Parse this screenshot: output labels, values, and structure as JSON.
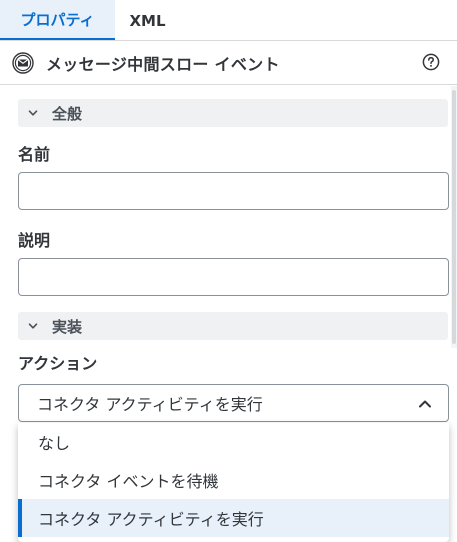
{
  "tabs": [
    {
      "label": "プロパティ",
      "active": true
    },
    {
      "label": "XML",
      "active": false
    }
  ],
  "header": {
    "title": "メッセージ中間スロー イベント",
    "icon": "envelope-event-icon",
    "help_icon": "help-icon"
  },
  "sections": {
    "general": {
      "label": "全般",
      "expanded": true
    },
    "implementation": {
      "label": "実装",
      "expanded": true
    }
  },
  "fields": {
    "name": {
      "label": "名前",
      "value": "",
      "placeholder": ""
    },
    "description": {
      "label": "説明",
      "value": "",
      "placeholder": ""
    },
    "action": {
      "label": "アクション",
      "selected": "コネクタ アクティビティを実行",
      "open": true,
      "options": [
        "なし",
        "コネクタ イベントを待機",
        "コネクタ アクティビティを実行"
      ]
    }
  },
  "colors": {
    "accent": "#0a6ed1",
    "selected_bg": "#e8f1fa",
    "section_bg": "#eff1f3",
    "text": "#32363a"
  }
}
